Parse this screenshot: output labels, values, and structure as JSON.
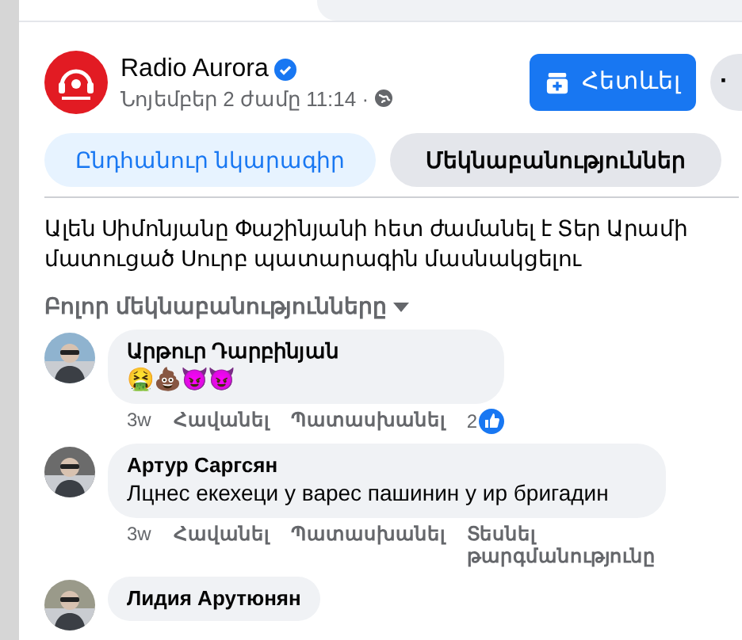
{
  "post": {
    "page_name": "Radio Aurora",
    "verified": true,
    "meta": "Նոյեմբեր 2 ժամը 11:14 ·",
    "follow_button": "Հետևել",
    "more_button": "·"
  },
  "tabs": [
    {
      "label": "Ընդհանուր նկարագիր",
      "selected": false
    },
    {
      "label": "Մեկնաբանություններ",
      "selected": true
    }
  ],
  "post_text": "Ալեն Սիմոնյանը Փաշինյանի հետ ժամանել է Տեր Արամի մատուցած Սուրբ պատարագին մասնակցելու",
  "comment_filter": "Բոլոր մեկնաբանությունները",
  "comments": [
    {
      "author": "Արթուր Դարբինյան",
      "text": "🤮💩😈😈",
      "time": "3w",
      "like": "Հավանել",
      "reply": "Պատասխանել",
      "reactions": "2"
    },
    {
      "author": "Артур Саргсян",
      "text": "Лцнес екехеци у варес пашинин у ир бригадин",
      "time": "3w",
      "like": "Հավանել",
      "reply": "Պատասխանել",
      "translate": "Տեսնել թարգմանությունը"
    },
    {
      "author": "Лидия Арутюнян"
    }
  ]
}
